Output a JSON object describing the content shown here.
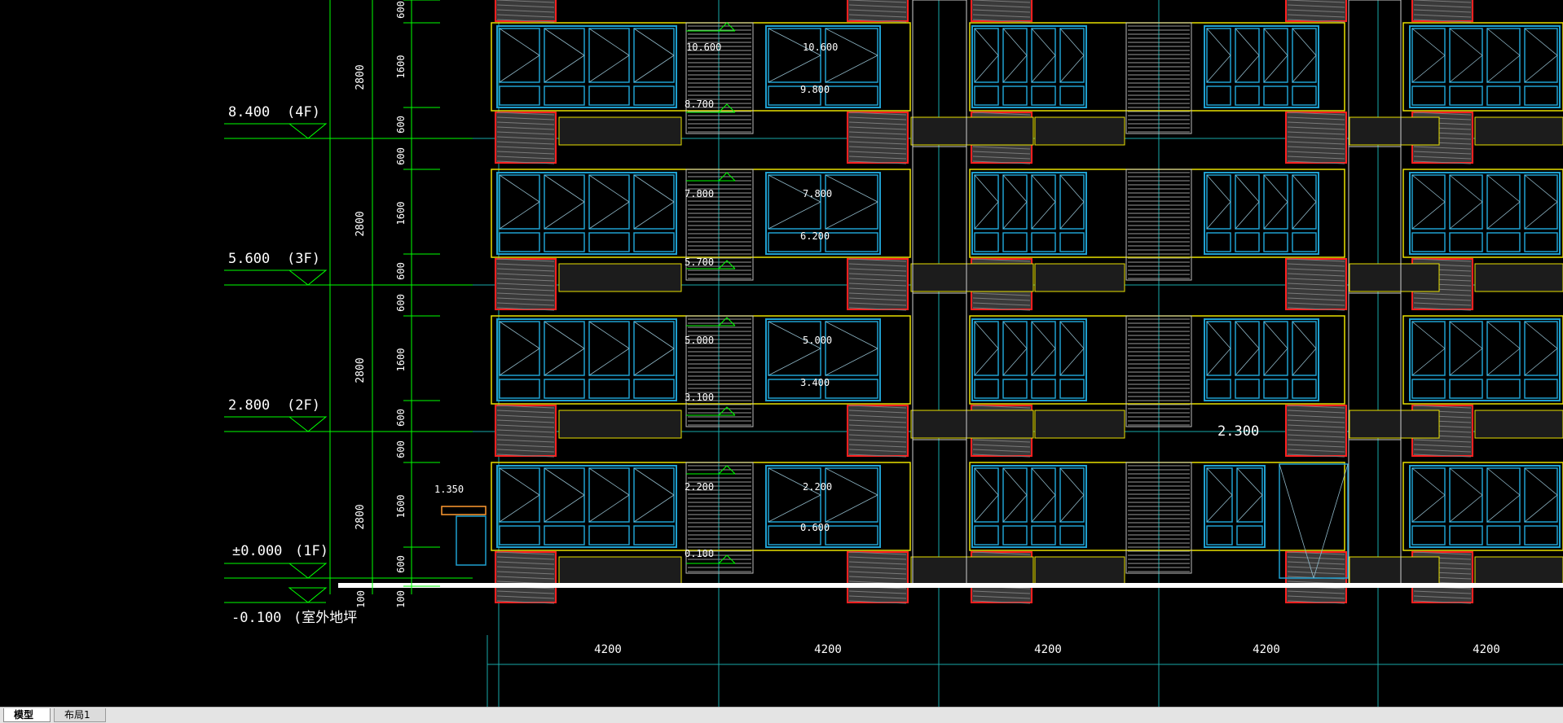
{
  "colors": {
    "background": "#000000",
    "frame": "#e8e000",
    "window": "#1fa0d0",
    "panel_border": "#ff2020",
    "dimension": "#00ff00",
    "grid_axis": "#19a8a8",
    "text": "#ffffff"
  },
  "levels": [
    {
      "elevation": "8.400",
      "floor": "(4F)"
    },
    {
      "elevation": "5.600",
      "floor": "(3F)"
    },
    {
      "elevation": "2.800",
      "floor": "(2F)"
    },
    {
      "elevation": "±0.000",
      "floor": "(1F)"
    },
    {
      "elevation": "-0.100",
      "floor": "(室外地坪"
    }
  ],
  "storey_dims": [
    "2800",
    "2800",
    "2800",
    "2800"
  ],
  "sub_dims": {
    "top_partial": "600",
    "f4": [
      "1600",
      "600"
    ],
    "f3": [
      "600",
      "1600",
      "600"
    ],
    "f2": [
      "600",
      "1600",
      "600"
    ],
    "f1": [
      "600",
      "1600",
      "600"
    ],
    "base": [
      "100",
      "100"
    ]
  },
  "canopy_elevation": "1.350",
  "entrance_elevation": "2.300",
  "stair_left": {
    "top": "10.600",
    "floors": [
      {
        "upper": "8.700",
        "mid": "7.800"
      },
      {
        "upper": "5.700",
        "mid": "5.000"
      },
      {
        "upper": "3.100",
        "mid": "2.200"
      },
      {
        "upper": "0.100",
        "mid": ""
      }
    ]
  },
  "stair_right": {
    "top": "10.600",
    "floors": [
      {
        "upper": "9.800",
        "mid": "7.800"
      },
      {
        "upper": "6.200",
        "mid": "5.000"
      },
      {
        "upper": "3.400",
        "mid": "2.200"
      },
      {
        "upper": "0.600",
        "mid": ""
      }
    ]
  },
  "bay_dims": [
    "4200",
    "4200",
    "4200",
    "4200",
    "4200"
  ],
  "tabs": {
    "model": "模型",
    "layout1": "布局1"
  }
}
